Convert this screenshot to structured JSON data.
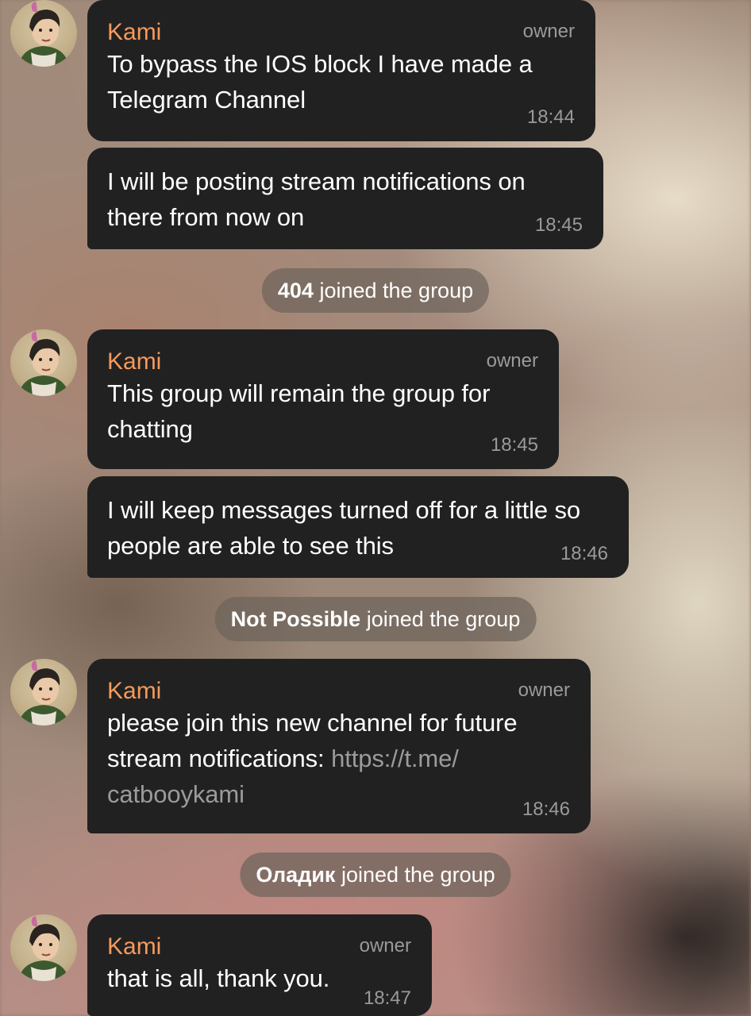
{
  "messages": [
    {
      "sender": "Kami",
      "role": "owner",
      "bubbles": [
        {
          "text": "To bypass the IOS block I have made a Telegram Channel",
          "time": "18:44"
        },
        {
          "text": "I will be posting stream notifications on there from now on",
          "time": "18:45"
        }
      ]
    },
    {
      "sender": "Kami",
      "role": "owner",
      "bubbles": [
        {
          "text": "This group will remain the group for chatting",
          "time": "18:45"
        },
        {
          "text": "I will keep messages turned off for a little so people are able to see this",
          "time": "18:46"
        }
      ]
    },
    {
      "sender": "Kami",
      "role": "owner",
      "bubbles": [
        {
          "text": "please join this new channel for future stream notifications: ",
          "link": "https://t.me/catbooykami",
          "link_line1": "https://t.me/",
          "link_line2": "catbooykami",
          "time": "18:46"
        }
      ]
    },
    {
      "sender": "Kami",
      "role": "owner",
      "bubbles": [
        {
          "text": "that is all, thank you.",
          "time": "18:47"
        }
      ]
    }
  ],
  "service": [
    {
      "name": "404",
      "action": " joined the group"
    },
    {
      "name": "Not Possible",
      "action": " joined the group"
    },
    {
      "name": "Оладик",
      "action": " joined the group"
    }
  ],
  "colors": {
    "bubble": "#212121",
    "sender": "#f59a5c",
    "meta": "#9a9a9a",
    "service_pill": "#6e645c"
  },
  "icons": [
    "avatar-icon"
  ]
}
